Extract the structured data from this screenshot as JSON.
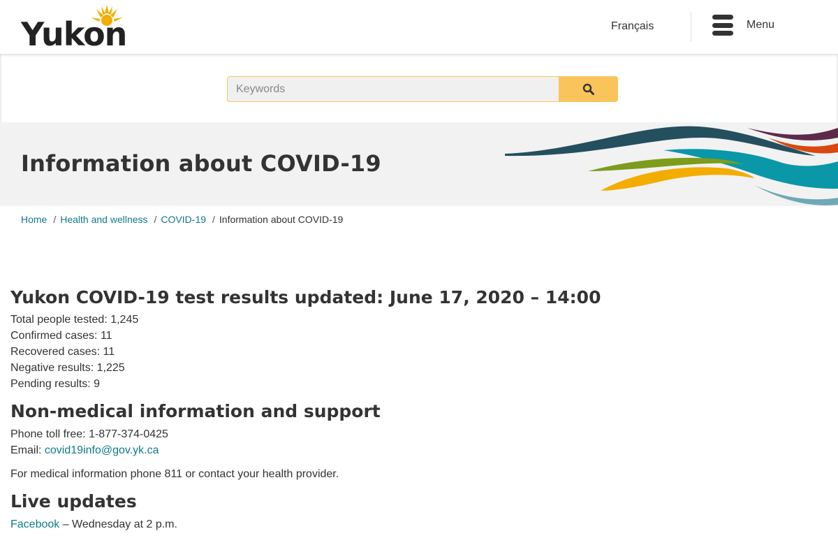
{
  "header": {
    "logo_text": "Yukon",
    "language_link": "Français",
    "menu_label": "Menu"
  },
  "search": {
    "placeholder": "Keywords"
  },
  "banner": {
    "title": "Information about COVID-19",
    "wave_colors": [
      "#244f5e",
      "#5c2b4a",
      "#d9480f",
      "#0a97a8",
      "#7d9c1b",
      "#f2ad00",
      "#6fa8b6"
    ]
  },
  "breadcrumb": {
    "items": [
      "Home",
      "Health and wellness",
      "COVID-19"
    ],
    "separator": "/",
    "current": "Information about COVID-19"
  },
  "results": {
    "heading": "Yukon COVID-19 test results updated: June 17, 2020 – 14:00",
    "stats": [
      "Total people tested: 1,245",
      "Confirmed cases: 11",
      "Recovered cases: 11",
      "Negative results: 1,225",
      "Pending results: 9"
    ]
  },
  "support": {
    "heading": "Non-medical information and support",
    "phone": "Phone toll free: 1-877-374-0425",
    "email_label": "Email: ",
    "email": "covid19info@gov.yk.ca",
    "medical_note": "For medical information phone 811 or contact your health provider."
  },
  "live": {
    "heading": "Live updates",
    "facebook_link": "Facebook",
    "facebook_schedule": " – Wednesday at 2 p.m."
  },
  "colors": {
    "link": "#0f7a8a",
    "search_button": "#f9c55a",
    "text": "#333333",
    "banner_bg": "#f2f2f2"
  }
}
